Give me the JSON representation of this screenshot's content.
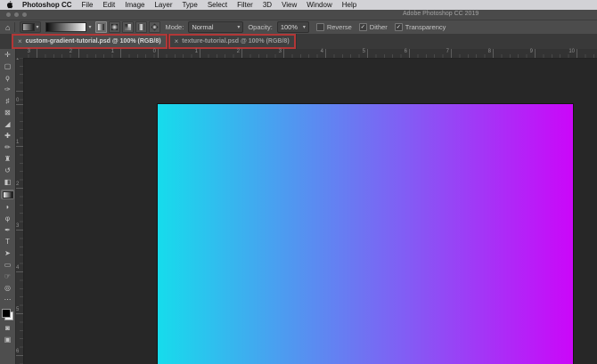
{
  "menu_bar": {
    "app_name": "Photoshop CC",
    "items": [
      "File",
      "Edit",
      "Image",
      "Layer",
      "Type",
      "Select",
      "Filter",
      "3D",
      "View",
      "Window",
      "Help"
    ]
  },
  "title_bar": {
    "title": "Adobe Photoshop CC 2019"
  },
  "options_bar": {
    "mode_label": "Mode:",
    "mode_value": "Normal",
    "opacity_label": "Opacity:",
    "opacity_value": "100%",
    "checkboxes": [
      {
        "label": "Reverse",
        "checked": false
      },
      {
        "label": "Dither",
        "checked": true
      },
      {
        "label": "Transparency",
        "checked": true
      }
    ],
    "gradient_preview": {
      "from": "#0b0b0b",
      "to": "#f6f6f6"
    },
    "gradient_types": [
      {
        "name": "linear",
        "selected": true
      },
      {
        "name": "radial",
        "selected": false
      },
      {
        "name": "angle",
        "selected": false
      },
      {
        "name": "reflected",
        "selected": false
      },
      {
        "name": "diamond",
        "selected": false
      }
    ]
  },
  "document_tabs": [
    {
      "close": "×",
      "label": "custom-gradient-tutorial.psd @ 100% (RGB/8)",
      "active": true,
      "annotated": true
    },
    {
      "close": "×",
      "label": "texture-tutorial.psd @ 100% (RGB/8)",
      "active": false,
      "annotated": true
    }
  ],
  "annotation_color": "#b23737",
  "toolbar": {
    "tools": [
      {
        "name": "move-tool",
        "glyph": "✛"
      },
      {
        "name": "marquee-tool",
        "glyph": "▢"
      },
      {
        "name": "lasso-tool",
        "glyph": "ϙ"
      },
      {
        "name": "quick-selection-tool",
        "glyph": "✑"
      },
      {
        "name": "crop-tool",
        "glyph": "♯"
      },
      {
        "name": "frame-tool",
        "glyph": "⊠"
      },
      {
        "name": "eyedropper-tool",
        "glyph": "◢"
      },
      {
        "name": "healing-brush-tool",
        "glyph": "✚"
      },
      {
        "name": "brush-tool",
        "glyph": "✏"
      },
      {
        "name": "clone-stamp-tool",
        "glyph": "♜"
      },
      {
        "name": "history-brush-tool",
        "glyph": "↺"
      },
      {
        "name": "eraser-tool",
        "glyph": "◧"
      },
      {
        "name": "gradient-tool",
        "glyph": "",
        "selected": true,
        "swatch": true
      },
      {
        "name": "blur-tool",
        "glyph": "◗"
      },
      {
        "name": "dodge-tool",
        "glyph": "φ"
      },
      {
        "name": "pen-tool",
        "glyph": "✒"
      },
      {
        "name": "type-tool",
        "glyph": "T"
      },
      {
        "name": "path-selection-tool",
        "glyph": "➤"
      },
      {
        "name": "rectangle-tool",
        "glyph": "▭"
      },
      {
        "name": "hand-tool",
        "glyph": "☞"
      },
      {
        "name": "zoom-tool",
        "glyph": "◎"
      },
      {
        "name": "edit-toolbar",
        "glyph": "⋯"
      }
    ],
    "color_swatches": {
      "foreground": "#000000",
      "background": "#ffffff"
    },
    "bottom": [
      {
        "name": "quick-mask-button",
        "glyph": "◙"
      },
      {
        "name": "screen-mode-button",
        "glyph": "▣"
      }
    ]
  },
  "rulers": {
    "horizontal_labels": [
      "3",
      "2",
      "1",
      "0",
      "1",
      "2",
      "3",
      "4",
      "5",
      "6",
      "7",
      "8",
      "9",
      "10"
    ],
    "vertical_labels": [
      "1",
      "0",
      "1",
      "2",
      "3",
      "4",
      "5",
      "6"
    ]
  },
  "canvas": {
    "type": "gradient-fill",
    "gradient_from": "#16dcec",
    "gradient_to": "#cb07f9",
    "direction": "left-to-right"
  }
}
